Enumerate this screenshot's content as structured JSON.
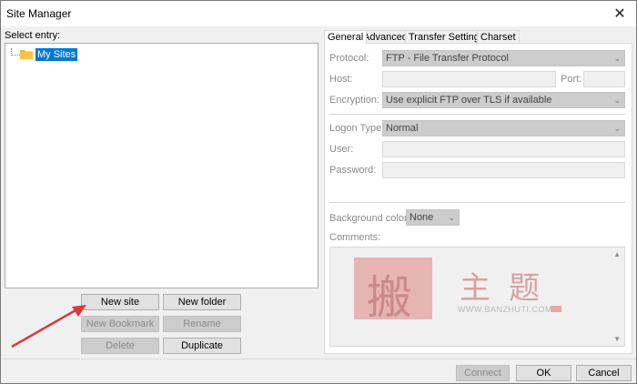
{
  "window": {
    "title": "Site Manager"
  },
  "left": {
    "select_label": "Select entry:",
    "tree": [
      {
        "label": "My Sites",
        "icon": "folder-icon",
        "selected": true
      }
    ],
    "buttons": {
      "new_site": "New site",
      "new_folder": "New folder",
      "new_bookmark": "New Bookmark",
      "rename": "Rename",
      "delete": "Delete",
      "duplicate": "Duplicate"
    }
  },
  "tabs": [
    {
      "label": "General",
      "active": true
    },
    {
      "label": "Advanced",
      "active": false
    },
    {
      "label": "Transfer Settings",
      "active": false
    },
    {
      "label": "Charset",
      "active": false
    }
  ],
  "general": {
    "protocol_label": "Protocol:",
    "protocol_value": "FTP - File Transfer Protocol",
    "host_label": "Host:",
    "host_value": "",
    "port_label": "Port:",
    "port_value": "",
    "encryption_label": "Encryption:",
    "encryption_value": "Use explicit FTP over TLS if available",
    "logon_type_label": "Logon Type:",
    "logon_type_value": "Normal",
    "user_label": "User:",
    "user_value": "",
    "password_label": "Password:",
    "password_value": "",
    "background_color_label": "Background color:",
    "background_color_value": "None",
    "comments_label": "Comments:"
  },
  "watermark": {
    "logo_char": "搬",
    "chars": [
      "主",
      "题"
    ],
    "url": "WWW.BANZHUTI.COM"
  },
  "footer": {
    "connect": "Connect",
    "ok": "OK",
    "cancel": "Cancel"
  },
  "colors": {
    "selection": "#0078d7",
    "arrow": "#d93b3b",
    "disabled_text": "#8a8a8a"
  }
}
